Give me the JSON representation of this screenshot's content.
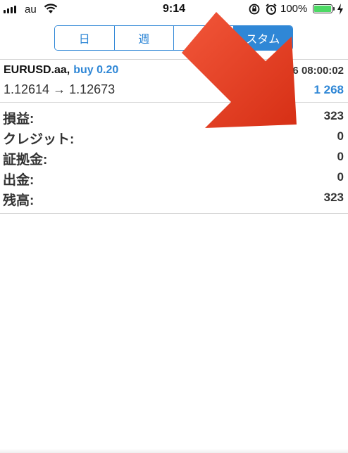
{
  "status_bar": {
    "carrier": "au",
    "time": "9:14",
    "battery_percent": "100%",
    "icons": [
      "signal-icon",
      "wifi-icon",
      "rotation-lock-icon",
      "alarm-icon",
      "battery-icon",
      "charging-icon"
    ]
  },
  "period_tabs": [
    {
      "label": "日",
      "selected": false
    },
    {
      "label": "週",
      "selected": false
    },
    {
      "label": "",
      "selected": false
    },
    {
      "label": "スタム",
      "selected": true
    }
  ],
  "trade": {
    "symbol": "EURUSD.aa,",
    "side": "buy 0.20",
    "time": "16 08:00:02",
    "prices": "1.12614 → 1.12673",
    "profit": "1 268"
  },
  "summary": [
    {
      "label": "損益:",
      "value": "323"
    },
    {
      "label": "クレジット:",
      "value": "0"
    },
    {
      "label": "証拠金:",
      "value": "0"
    },
    {
      "label": "出金:",
      "value": "0"
    },
    {
      "label": "残高:",
      "value": "323"
    }
  ],
  "colors": {
    "accent": "#2f87d6",
    "arrow": "#e63c22",
    "battery": "#4cd964"
  }
}
